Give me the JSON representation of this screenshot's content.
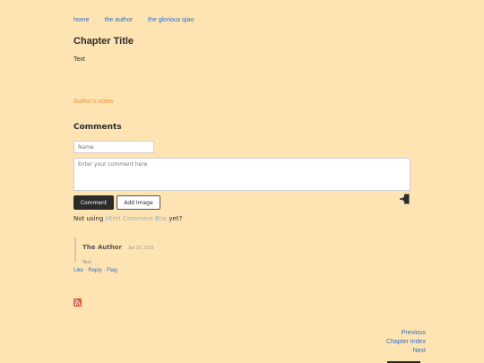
{
  "nav": {
    "items": [
      "home",
      "the author",
      "the glorious qiao"
    ]
  },
  "chapter": {
    "title": "Chapter Title",
    "text": "Text",
    "author_notes": "Author's notes"
  },
  "comments": {
    "heading": "Comments",
    "name_placeholder": "Name",
    "comment_placeholder": "Enter your comment here",
    "comment_button": "Comment",
    "image_button": "Add Image",
    "not_using_prefix": "Not using ",
    "not_using_link": "Html Comment Box",
    "not_using_suffix": " yet?",
    "entries": [
      {
        "author": "The Author",
        "date": "Jan 25, 2023",
        "body": "Test",
        "actions": [
          "Like",
          "Reply",
          "Flag"
        ]
      }
    ]
  },
  "chapter_nav": {
    "previous": "Previous",
    "index": "Chapter Index",
    "next": "Next"
  },
  "colors": {
    "background": "#ffe4b3",
    "link": "#2d6fc4",
    "notes": "#f0913a",
    "rss": "#e2593b"
  }
}
